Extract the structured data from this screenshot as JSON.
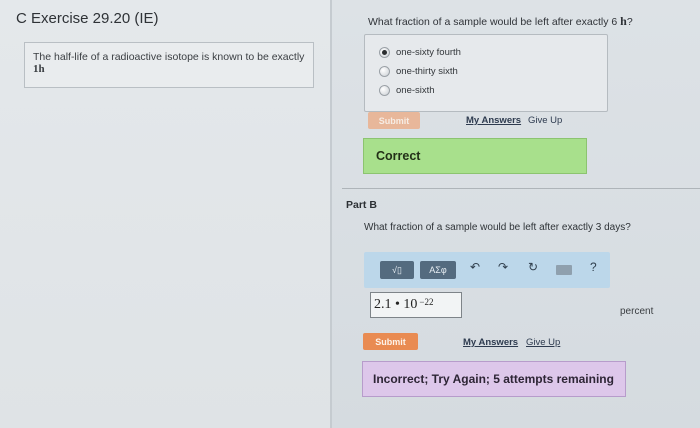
{
  "left": {
    "title": "C Exercise 29.20 (IE)",
    "problem_text": "The half-life of a radioactive isotope is known to be exactly",
    "problem_value": "1h"
  },
  "partA": {
    "question_text": "What fraction of a sample would be left after exactly 6",
    "question_unit": "h",
    "question_end": "?",
    "options": [
      {
        "label": "one-sixty fourth",
        "selected": true
      },
      {
        "label": "one-thirty sixth",
        "selected": false
      },
      {
        "label": "one-sixth",
        "selected": false
      }
    ],
    "submit_label": "Submit",
    "my_answers_label": "My Answers",
    "give_up_label": "Give Up",
    "feedback": "Correct",
    "feedback_color": "#a8e08c"
  },
  "partB": {
    "title": "Part B",
    "question": "What fraction of a sample would be left after exactly 3 days?",
    "toolbar": {
      "template_label": "√▯",
      "symbols_label": "ΑΣφ",
      "undo_icon": "undo-icon",
      "redo_icon": "redo-icon",
      "reset_icon": "reset-icon",
      "keyboard_icon": "keyboard-icon",
      "help_label": "?"
    },
    "answer_mantissa": "2.1",
    "answer_dot": "•",
    "answer_base": "10",
    "answer_exponent": "−22",
    "unit": "percent",
    "submit_label": "Submit",
    "my_answers_label": "My Answers",
    "give_up_label": "Give Up",
    "feedback": "Incorrect; Try Again; 5 attempts remaining",
    "feedback_color": "#ddc7ea"
  }
}
